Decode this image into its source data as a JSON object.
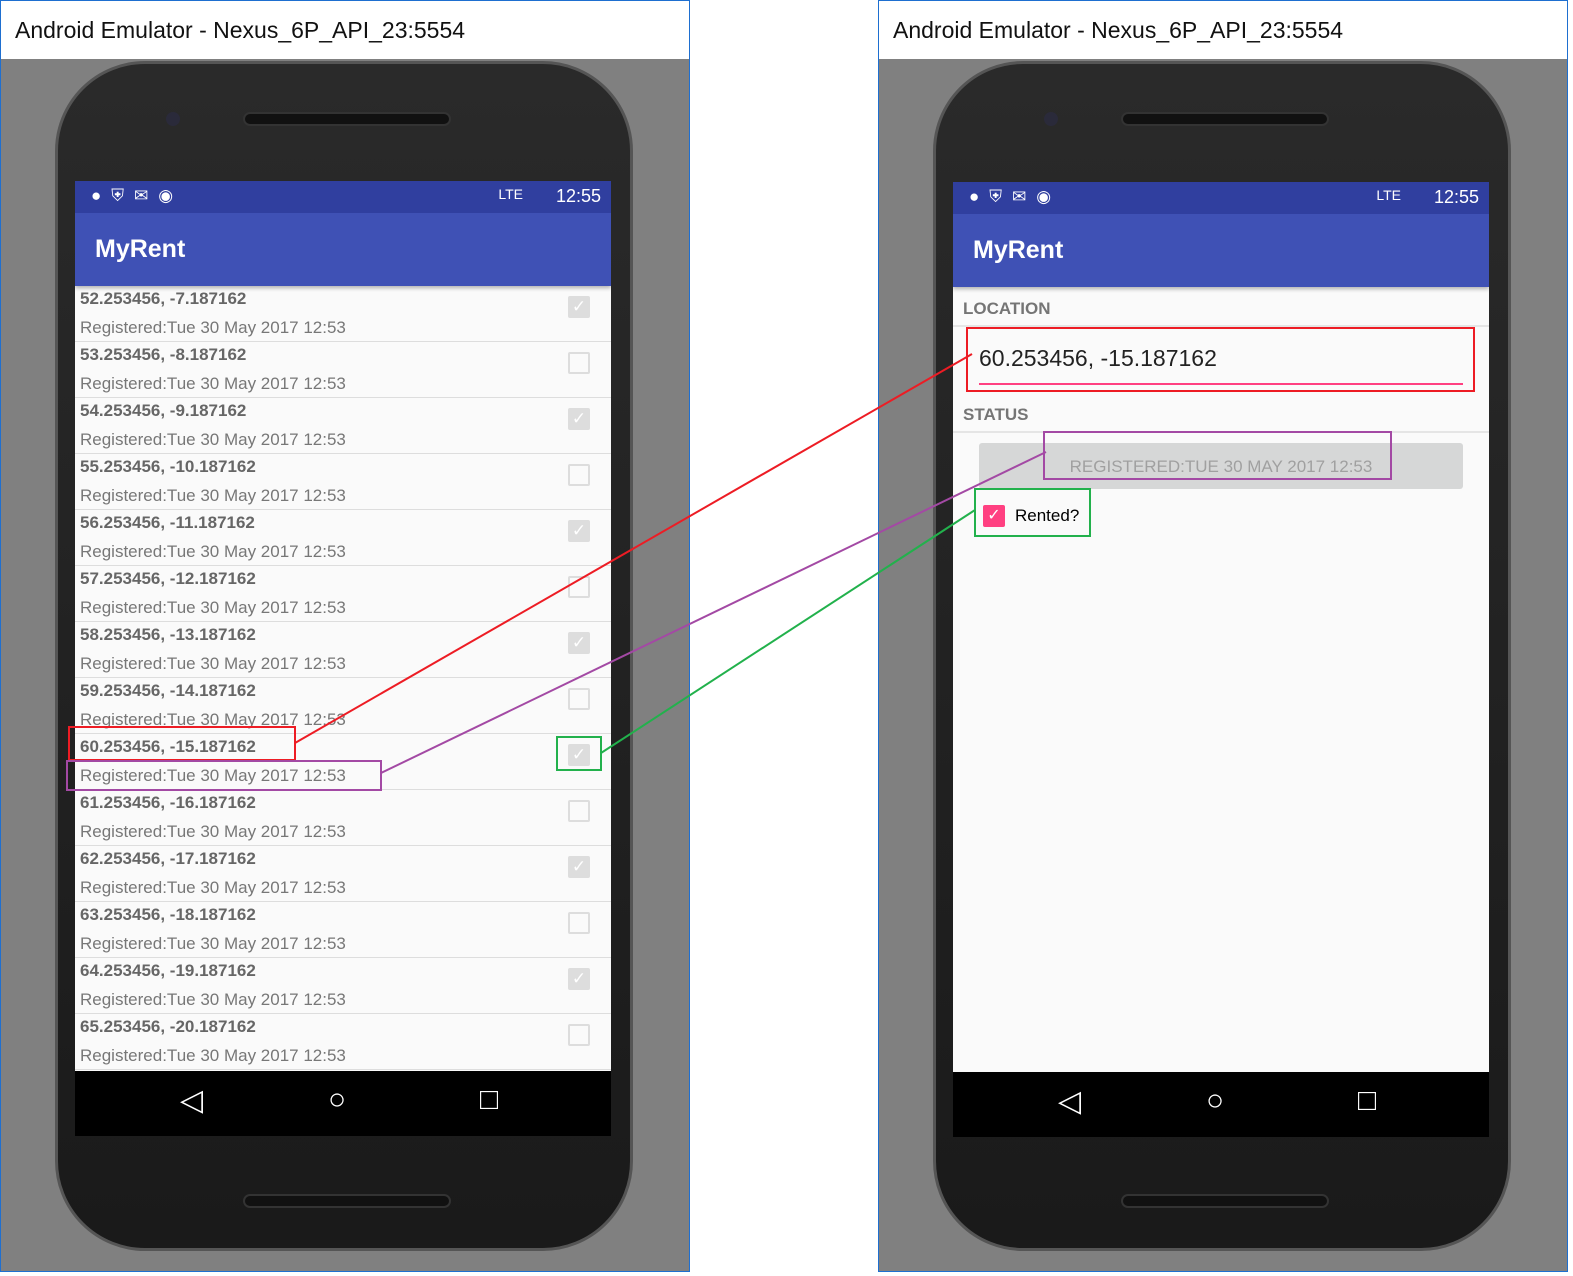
{
  "window_title": "Android Emulator - Nexus_6P_API_23:5554",
  "status_time": "12:55",
  "status_signal": "LTE",
  "app_title": "MyRent",
  "list": [
    {
      "loc": "52.253456, -7.187162",
      "reg": "Registered:Tue 30 May 2017 12:53",
      "rented": true
    },
    {
      "loc": "53.253456, -8.187162",
      "reg": "Registered:Tue 30 May 2017 12:53",
      "rented": false
    },
    {
      "loc": "54.253456, -9.187162",
      "reg": "Registered:Tue 30 May 2017 12:53",
      "rented": true
    },
    {
      "loc": "55.253456, -10.187162",
      "reg": "Registered:Tue 30 May 2017 12:53",
      "rented": false
    },
    {
      "loc": "56.253456, -11.187162",
      "reg": "Registered:Tue 30 May 2017 12:53",
      "rented": true
    },
    {
      "loc": "57.253456, -12.187162",
      "reg": "Registered:Tue 30 May 2017 12:53",
      "rented": false
    },
    {
      "loc": "58.253456, -13.187162",
      "reg": "Registered:Tue 30 May 2017 12:53",
      "rented": true
    },
    {
      "loc": "59.253456, -14.187162",
      "reg": "Registered:Tue 30 May 2017 12:53",
      "rented": false
    },
    {
      "loc": "60.253456, -15.187162",
      "reg": "Registered:Tue 30 May 2017 12:53",
      "rented": true
    },
    {
      "loc": "61.253456, -16.187162",
      "reg": "Registered:Tue 30 May 2017 12:53",
      "rented": false
    },
    {
      "loc": "62.253456, -17.187162",
      "reg": "Registered:Tue 30 May 2017 12:53",
      "rented": true
    },
    {
      "loc": "63.253456, -18.187162",
      "reg": "Registered:Tue 30 May 2017 12:53",
      "rented": false
    },
    {
      "loc": "64.253456, -19.187162",
      "reg": "Registered:Tue 30 May 2017 12:53",
      "rented": true
    },
    {
      "loc": "65.253456, -20.187162",
      "reg": "Registered:Tue 30 May 2017 12:53",
      "rented": false
    }
  ],
  "detail": {
    "location_label": "LOCATION",
    "location_value": "60.253456, -15.187162",
    "status_label": "STATUS",
    "registered_button": "REGISTERED:TUE 30 MAY 2017 12:53",
    "rented_label": "Rented?",
    "rented": true
  },
  "colors": {
    "status_bar": "#303f9f",
    "toolbar": "#3f51b5",
    "accent": "#ff4081",
    "annot_red": "#ed1c24",
    "annot_purple": "#a349a4",
    "annot_green": "#22b14c"
  }
}
